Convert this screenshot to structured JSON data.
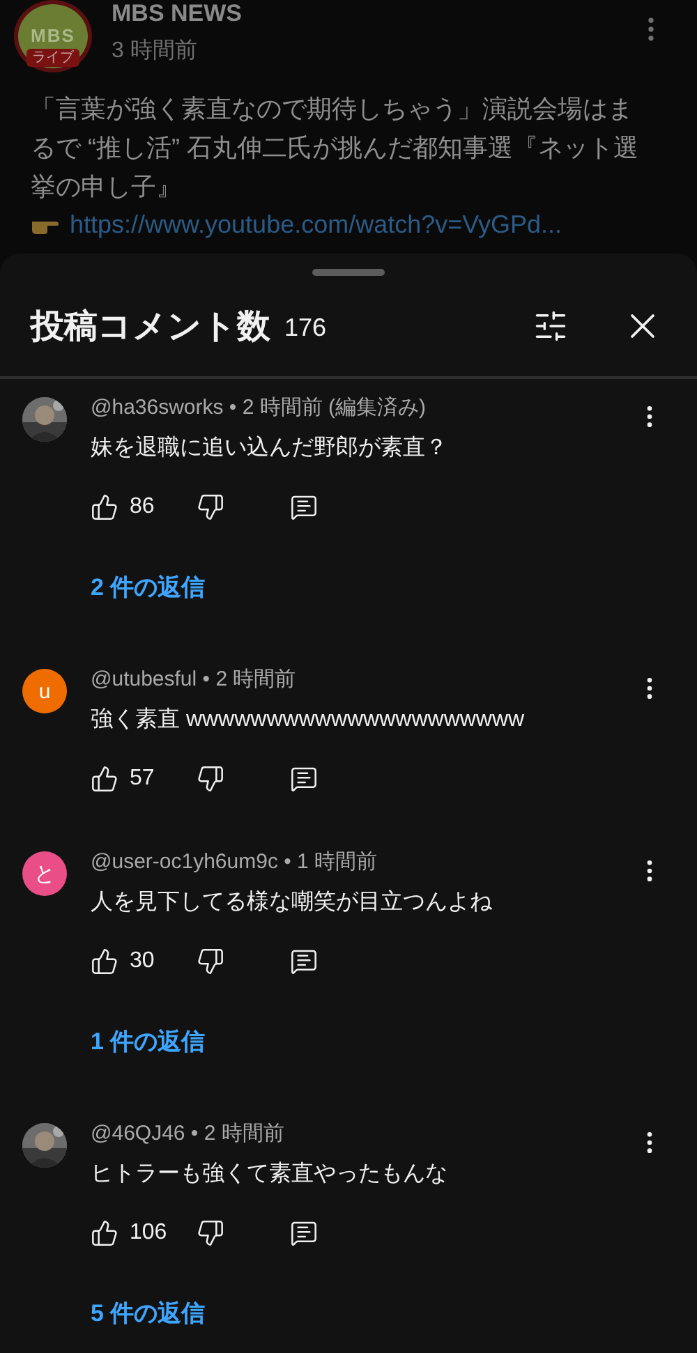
{
  "post": {
    "channel": {
      "logo_text": "MBS",
      "live_badge": "ライブ",
      "name": "MBS NEWS",
      "time": "3 時間前"
    },
    "text": "「言葉が強く素直なので期待しちゃう」演説会場はまるで “推し活” 石丸伸二氏が挑んだ都知事選『ネット選挙の申し子』",
    "link": "https://www.youtube.com/watch?v=VyGPd..."
  },
  "sheet": {
    "title": "投稿コメント数",
    "count": "176"
  },
  "comments": [
    {
      "meta": "@ha36sworks • 2 時間前 (編集済み)",
      "text": "妹を退職に追い込んだ野郎が素直？",
      "likes": "86",
      "replies": "2 件の返信"
    },
    {
      "avatar": {
        "kind": "letter",
        "letter": "u",
        "color": "#ef6c00"
      },
      "meta": "@utubesful • 2 時間前",
      "text": "強く素直 wwwwwwwwwwwwwwwwwwwww",
      "likes": "57"
    },
    {
      "avatar": {
        "kind": "letter",
        "letter": "と",
        "color": "#e94f86"
      },
      "meta": "@user-oc1yh6um9c • 1 時間前",
      "text": "人を見下してる様な嘲笑が目立つんよね",
      "likes": "30",
      "replies": "1 件の返信"
    },
    {
      "meta": "@46QJ46 • 2 時間前",
      "text": "ヒトラーも強くて素直やったもんな",
      "likes": "106",
      "replies": "5 件の返信"
    }
  ]
}
